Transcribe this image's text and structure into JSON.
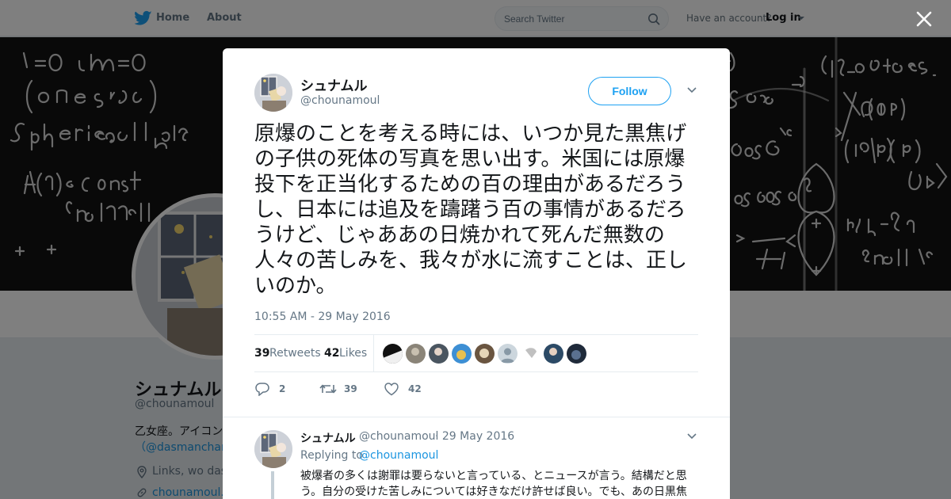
{
  "nav": {
    "home_label": "Home",
    "about_label": "About",
    "search_placeholder": "Search Twitter",
    "account_prompt": "Have an account?",
    "login_label": "Log in",
    "brand_color": "#1da1f2"
  },
  "background_profile": {
    "name": "シュナムル",
    "handle": "@chounamoul",
    "bio": "乙女座。アイコン",
    "bio_link": "（@dasmanchan",
    "location": "Links, wo das",
    "url": "chounamoul.e"
  },
  "tweet": {
    "author_name": "シュナムル",
    "author_handle": "@chounamoul",
    "follow_label": "Follow",
    "text": "原爆のことを考える時には、いつか見た黒焦げの子供の死体の写真を思い出す。米国には原爆投下を正当化するための百の理由があるだろうし、日本には追及を躊躇う百の事情があるだろうけど、じゃああの日焼かれて死んだ無数の人々の苦しみを、我々が水に流すことは、正しいのか。",
    "timestamp": "10:55 AM - 29 May 2016",
    "retweets_count": "39",
    "retweets_label": "Retweets",
    "likes_count": "42",
    "likes_label": "Likes",
    "actions": {
      "reply_count": "2",
      "retweet_count": "39",
      "like_count": "42"
    }
  },
  "reply": {
    "author_name": "シュナムル",
    "author_handle": "@chounamoul",
    "date": "· 29 May 2016",
    "replying_to_label": "Replying to",
    "replying_to_handle": "@chounamoul",
    "text": "被爆者の多くは謝罪は要らないと言っている、とニュースが言う。結構だと思う。自分の受けた苦しみについては好きなだけ許せば良い。でも、あの日黒焦"
  }
}
